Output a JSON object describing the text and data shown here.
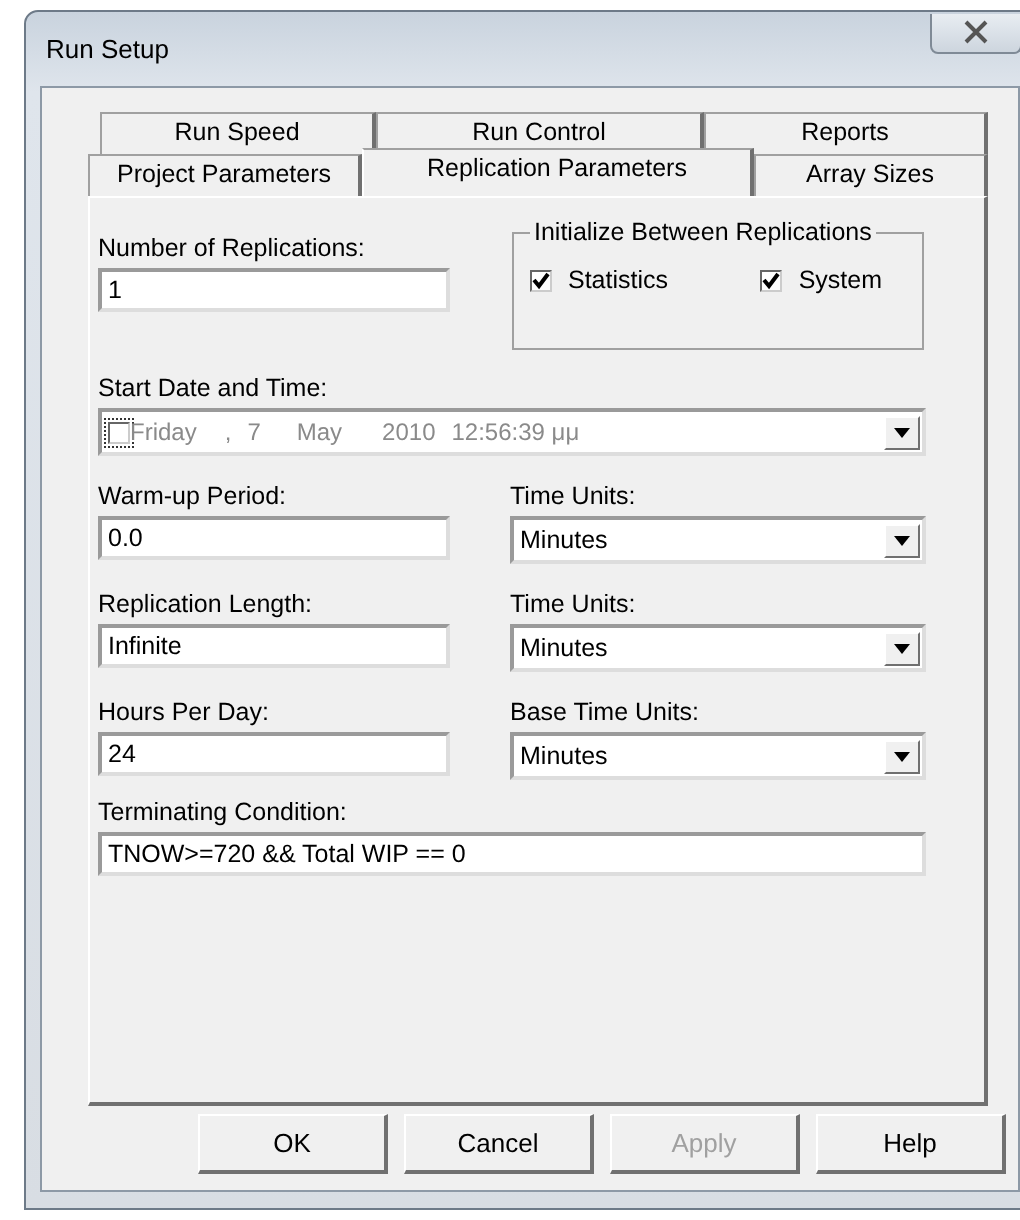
{
  "window": {
    "title": "Run Setup"
  },
  "tab_rows": [
    [
      {
        "label": "Run Speed",
        "selected": false
      },
      {
        "label": "Run Control",
        "selected": false
      },
      {
        "label": "Reports",
        "selected": false
      }
    ],
    [
      {
        "label": "Project Parameters",
        "selected": false
      },
      {
        "label": "Replication Parameters",
        "selected": true
      },
      {
        "label": "Array Sizes",
        "selected": false
      }
    ]
  ],
  "number_of_replications": {
    "label": "Number of Replications:",
    "value": "1"
  },
  "initialize_group": {
    "title": "Initialize Between Replications",
    "options": [
      {
        "label": "Statistics",
        "checked": true
      },
      {
        "label": "System",
        "checked": true
      }
    ]
  },
  "start_date": {
    "label": "Start Date and Time:",
    "checked": false,
    "parts": [
      "Friday",
      ",",
      "7",
      "May",
      "2010",
      "12:56:39 μμ"
    ]
  },
  "rows": [
    {
      "left": {
        "label": "Warm-up Period:",
        "value": "0.0"
      },
      "right": {
        "label": "Time Units:",
        "value": "Minutes"
      }
    },
    {
      "left": {
        "label": "Replication Length:",
        "value": "Infinite"
      },
      "right": {
        "label": "Time Units:",
        "value": "Minutes"
      }
    },
    {
      "left": {
        "label": "Hours Per Day:",
        "value": "24"
      },
      "right": {
        "label": "Base Time Units:",
        "value": "Minutes"
      }
    }
  ],
  "terminating_condition": {
    "label": "Terminating Condition:",
    "value": "TNOW>=720 && Total WIP == 0"
  },
  "buttons": [
    {
      "label": "OK",
      "disabled": false
    },
    {
      "label": "Cancel",
      "disabled": false
    },
    {
      "label": "Apply",
      "disabled": true
    },
    {
      "label": "Help",
      "disabled": false
    }
  ]
}
